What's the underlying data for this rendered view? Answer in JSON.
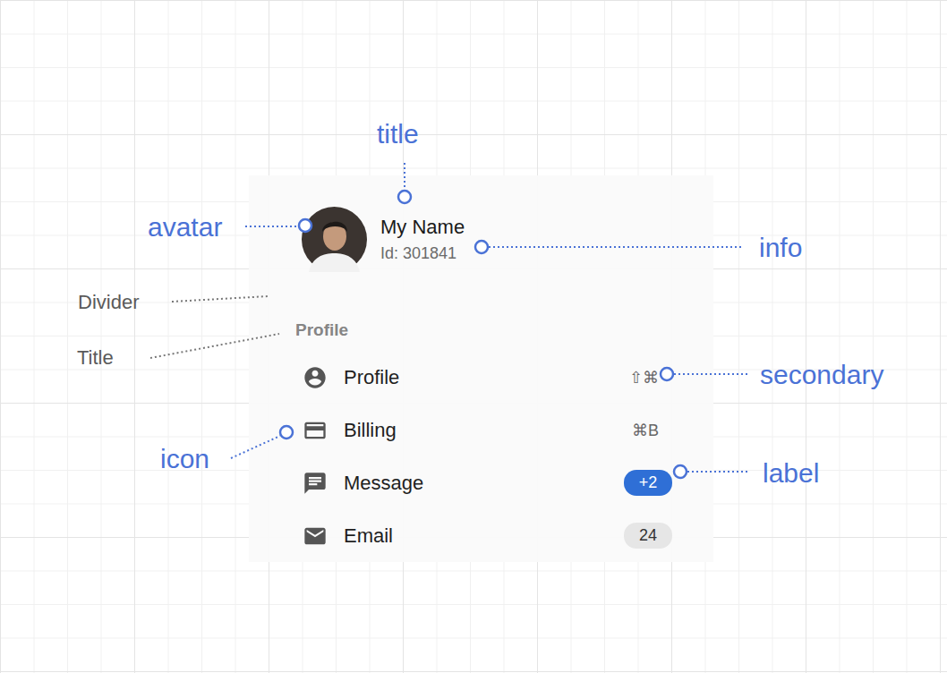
{
  "annotations": [
    {
      "text": "title",
      "kind": "prop"
    },
    {
      "text": "avatar",
      "kind": "prop"
    },
    {
      "text": "info",
      "kind": "prop"
    },
    {
      "text": "Divider",
      "kind": "part"
    },
    {
      "text": "Title",
      "kind": "part"
    },
    {
      "text": "secondary",
      "kind": "prop"
    },
    {
      "text": "icon",
      "kind": "prop"
    },
    {
      "text": "label",
      "kind": "prop"
    }
  ],
  "menu": {
    "header": {
      "title": "My Name",
      "info": "Id: 301841"
    },
    "section_title": "Profile",
    "items": [
      {
        "label": "Profile",
        "kind": "secondary",
        "value": "⇧⌘"
      },
      {
        "label": "Billing",
        "kind": "secondary",
        "value": "⌘B"
      },
      {
        "label": "Message",
        "kind": "badge",
        "value": "+2",
        "color": "#2f6fd6"
      },
      {
        "label": "Email",
        "kind": "badge",
        "value": "24",
        "color": "#e6e6e6"
      }
    ]
  }
}
